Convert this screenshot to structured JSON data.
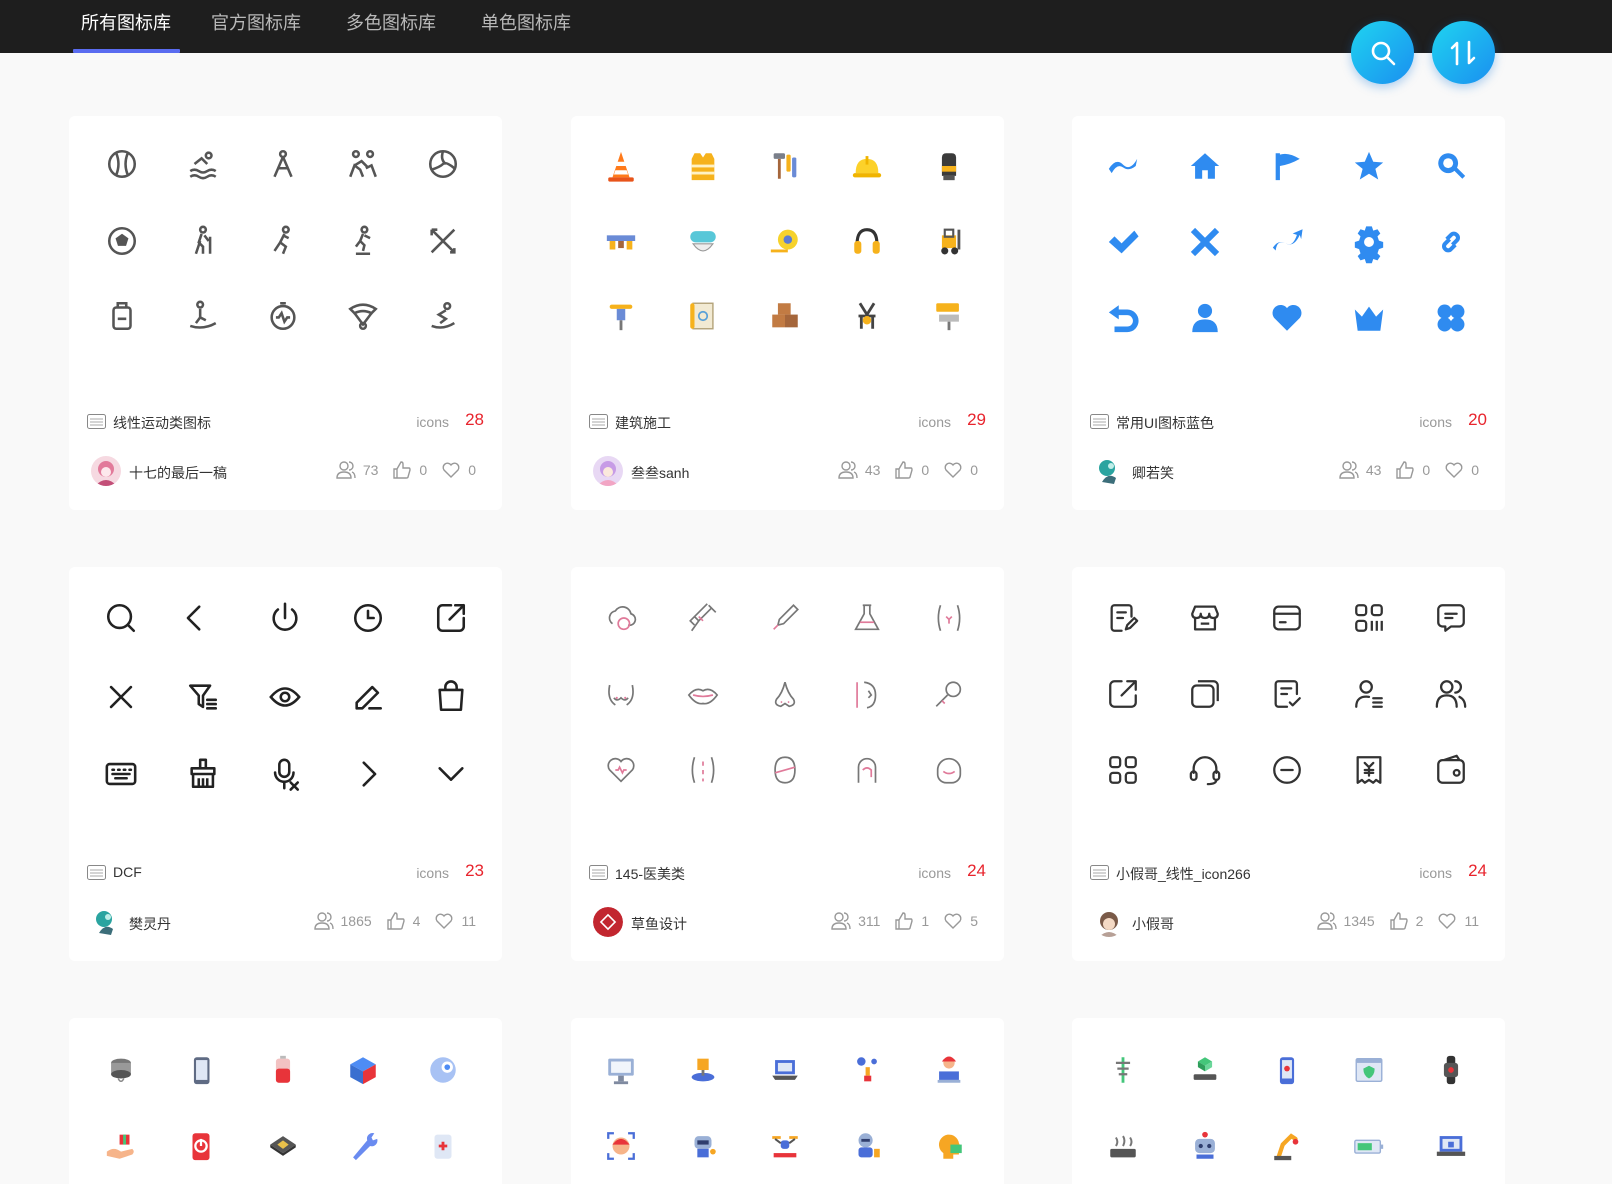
{
  "nav": {
    "tabs": [
      {
        "label": "所有图标库",
        "active": true
      },
      {
        "label": "官方图标库"
      },
      {
        "label": "多色图标库"
      },
      {
        "label": "单色图标库"
      }
    ]
  },
  "actions": {
    "search_icon": "search-icon",
    "sort_icon": "sort-icon"
  },
  "cards": [
    {
      "name": "线性运动类图标",
      "icons_label": "icons",
      "count": "28",
      "author": "十七的最后一稿",
      "followers": "73",
      "likes": "0",
      "favorites": "0"
    },
    {
      "name": "建筑施工",
      "icons_label": "icons",
      "count": "29",
      "author": "叁叁sanh",
      "followers": "43",
      "likes": "0",
      "favorites": "0"
    },
    {
      "name": "常用UI图标蓝色",
      "icons_label": "icons",
      "count": "20",
      "author": "卿若笑",
      "followers": "43",
      "likes": "0",
      "favorites": "0"
    },
    {
      "name": "DCF",
      "icons_label": "icons",
      "count": "23",
      "author": "樊灵丹",
      "followers": "1865",
      "likes": "4",
      "favorites": "11"
    },
    {
      "name": "145-医美类",
      "icons_label": "icons",
      "count": "24",
      "author": "草鱼设计",
      "followers": "311",
      "likes": "1",
      "favorites": "5"
    },
    {
      "name": "小假哥_线性_icon266",
      "icons_label": "icons",
      "count": "24",
      "author": "小假哥",
      "followers": "1345",
      "likes": "2",
      "favorites": "11"
    }
  ],
  "colors": {
    "accent": "#5a6cf0",
    "count": "#e8242d",
    "topbar": "#1e1e1e",
    "fab": "#1a8ff0"
  }
}
